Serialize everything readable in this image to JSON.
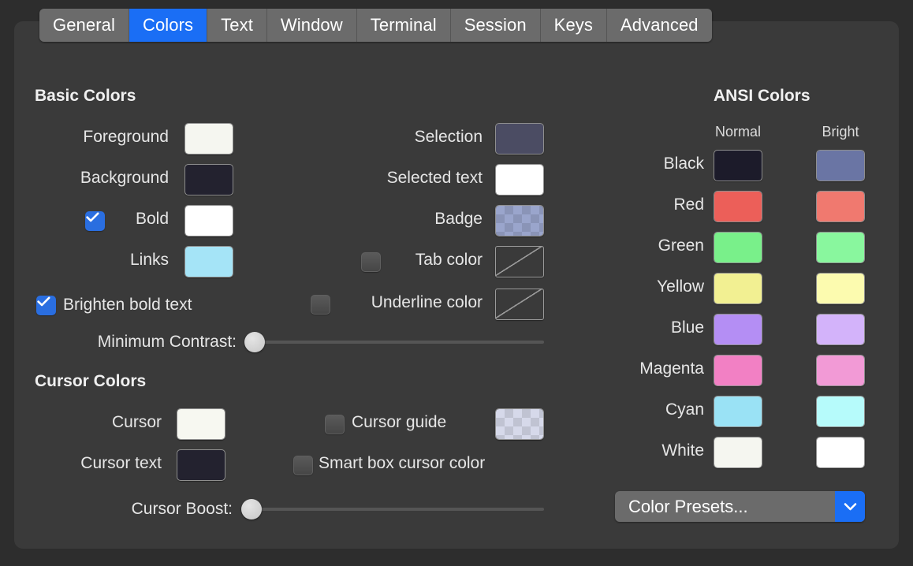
{
  "window": {
    "panel_background": "#3a3a3a",
    "page_background": "#2d2d2d",
    "accent": "#1a6ef5"
  },
  "tabs": [
    {
      "label": "General",
      "selected": false
    },
    {
      "label": "Colors",
      "selected": true
    },
    {
      "label": "Text",
      "selected": false
    },
    {
      "label": "Window",
      "selected": false
    },
    {
      "label": "Terminal",
      "selected": false
    },
    {
      "label": "Session",
      "selected": false
    },
    {
      "label": "Keys",
      "selected": false
    },
    {
      "label": "Advanced",
      "selected": false
    }
  ],
  "basic_colors": {
    "title": "Basic Colors",
    "left": [
      {
        "label": "Foreground",
        "color": "#f5f6f0",
        "checkbox": null
      },
      {
        "label": "Background",
        "color": "#23222f",
        "checkbox": null
      },
      {
        "label": "Bold",
        "color": "#ffffff",
        "checkbox": "checked"
      },
      {
        "label": "Links",
        "color": "#a5e4f7",
        "checkbox": null
      }
    ],
    "right": [
      {
        "label": "Selection",
        "color": "#4b4c63",
        "checkbox": null,
        "style": "solid"
      },
      {
        "label": "Selected text",
        "color": "#ffffff",
        "checkbox": null,
        "style": "solid"
      },
      {
        "label": "Badge",
        "color": "#9aa5cc",
        "checkbox": null,
        "style": "checker"
      },
      {
        "label": "Tab color",
        "color": null,
        "checkbox": "unchecked",
        "style": "none"
      },
      {
        "label": "Underline color",
        "color": null,
        "checkbox": "unchecked",
        "style": "none"
      }
    ],
    "brighten_bold_text": {
      "label": "Brighten bold text",
      "checkbox": "checked"
    },
    "minimum_contrast": {
      "label": "Minimum Contrast:",
      "value": 0
    }
  },
  "cursor_colors": {
    "title": "Cursor Colors",
    "left": [
      {
        "label": "Cursor",
        "color": "#f7f8f1"
      },
      {
        "label": "Cursor text",
        "color": "#23222f"
      }
    ],
    "right": [
      {
        "label": "Cursor guide",
        "color": "#d6d9ea",
        "checkbox": "unchecked",
        "style": "checker"
      },
      {
        "label": "Smart box cursor color",
        "color": null,
        "checkbox": "unchecked",
        "style": "none"
      }
    ],
    "cursor_boost": {
      "label": "Cursor Boost:",
      "value": 0
    }
  },
  "ansi_colors": {
    "title": "ANSI Colors",
    "columns": [
      "Normal",
      "Bright"
    ],
    "rows": [
      {
        "name": "Black",
        "normal": "#1c1b2a",
        "bright": "#6a75a4"
      },
      {
        "name": "Red",
        "normal": "#ec5f59",
        "bright": "#f0796f"
      },
      {
        "name": "Green",
        "normal": "#79f08a",
        "bright": "#89f79e"
      },
      {
        "name": "Yellow",
        "normal": "#f2f092",
        "bright": "#fcfbaf"
      },
      {
        "name": "Blue",
        "normal": "#b48ef4",
        "bright": "#d3b3fa"
      },
      {
        "name": "Magenta",
        "normal": "#f280c4",
        "bright": "#f29ad6"
      },
      {
        "name": "Cyan",
        "normal": "#9ae2f5",
        "bright": "#b6fbfb"
      },
      {
        "name": "White",
        "normal": "#f5f6f0",
        "bright": "#ffffff"
      }
    ],
    "presets_button": "Color Presets..."
  }
}
